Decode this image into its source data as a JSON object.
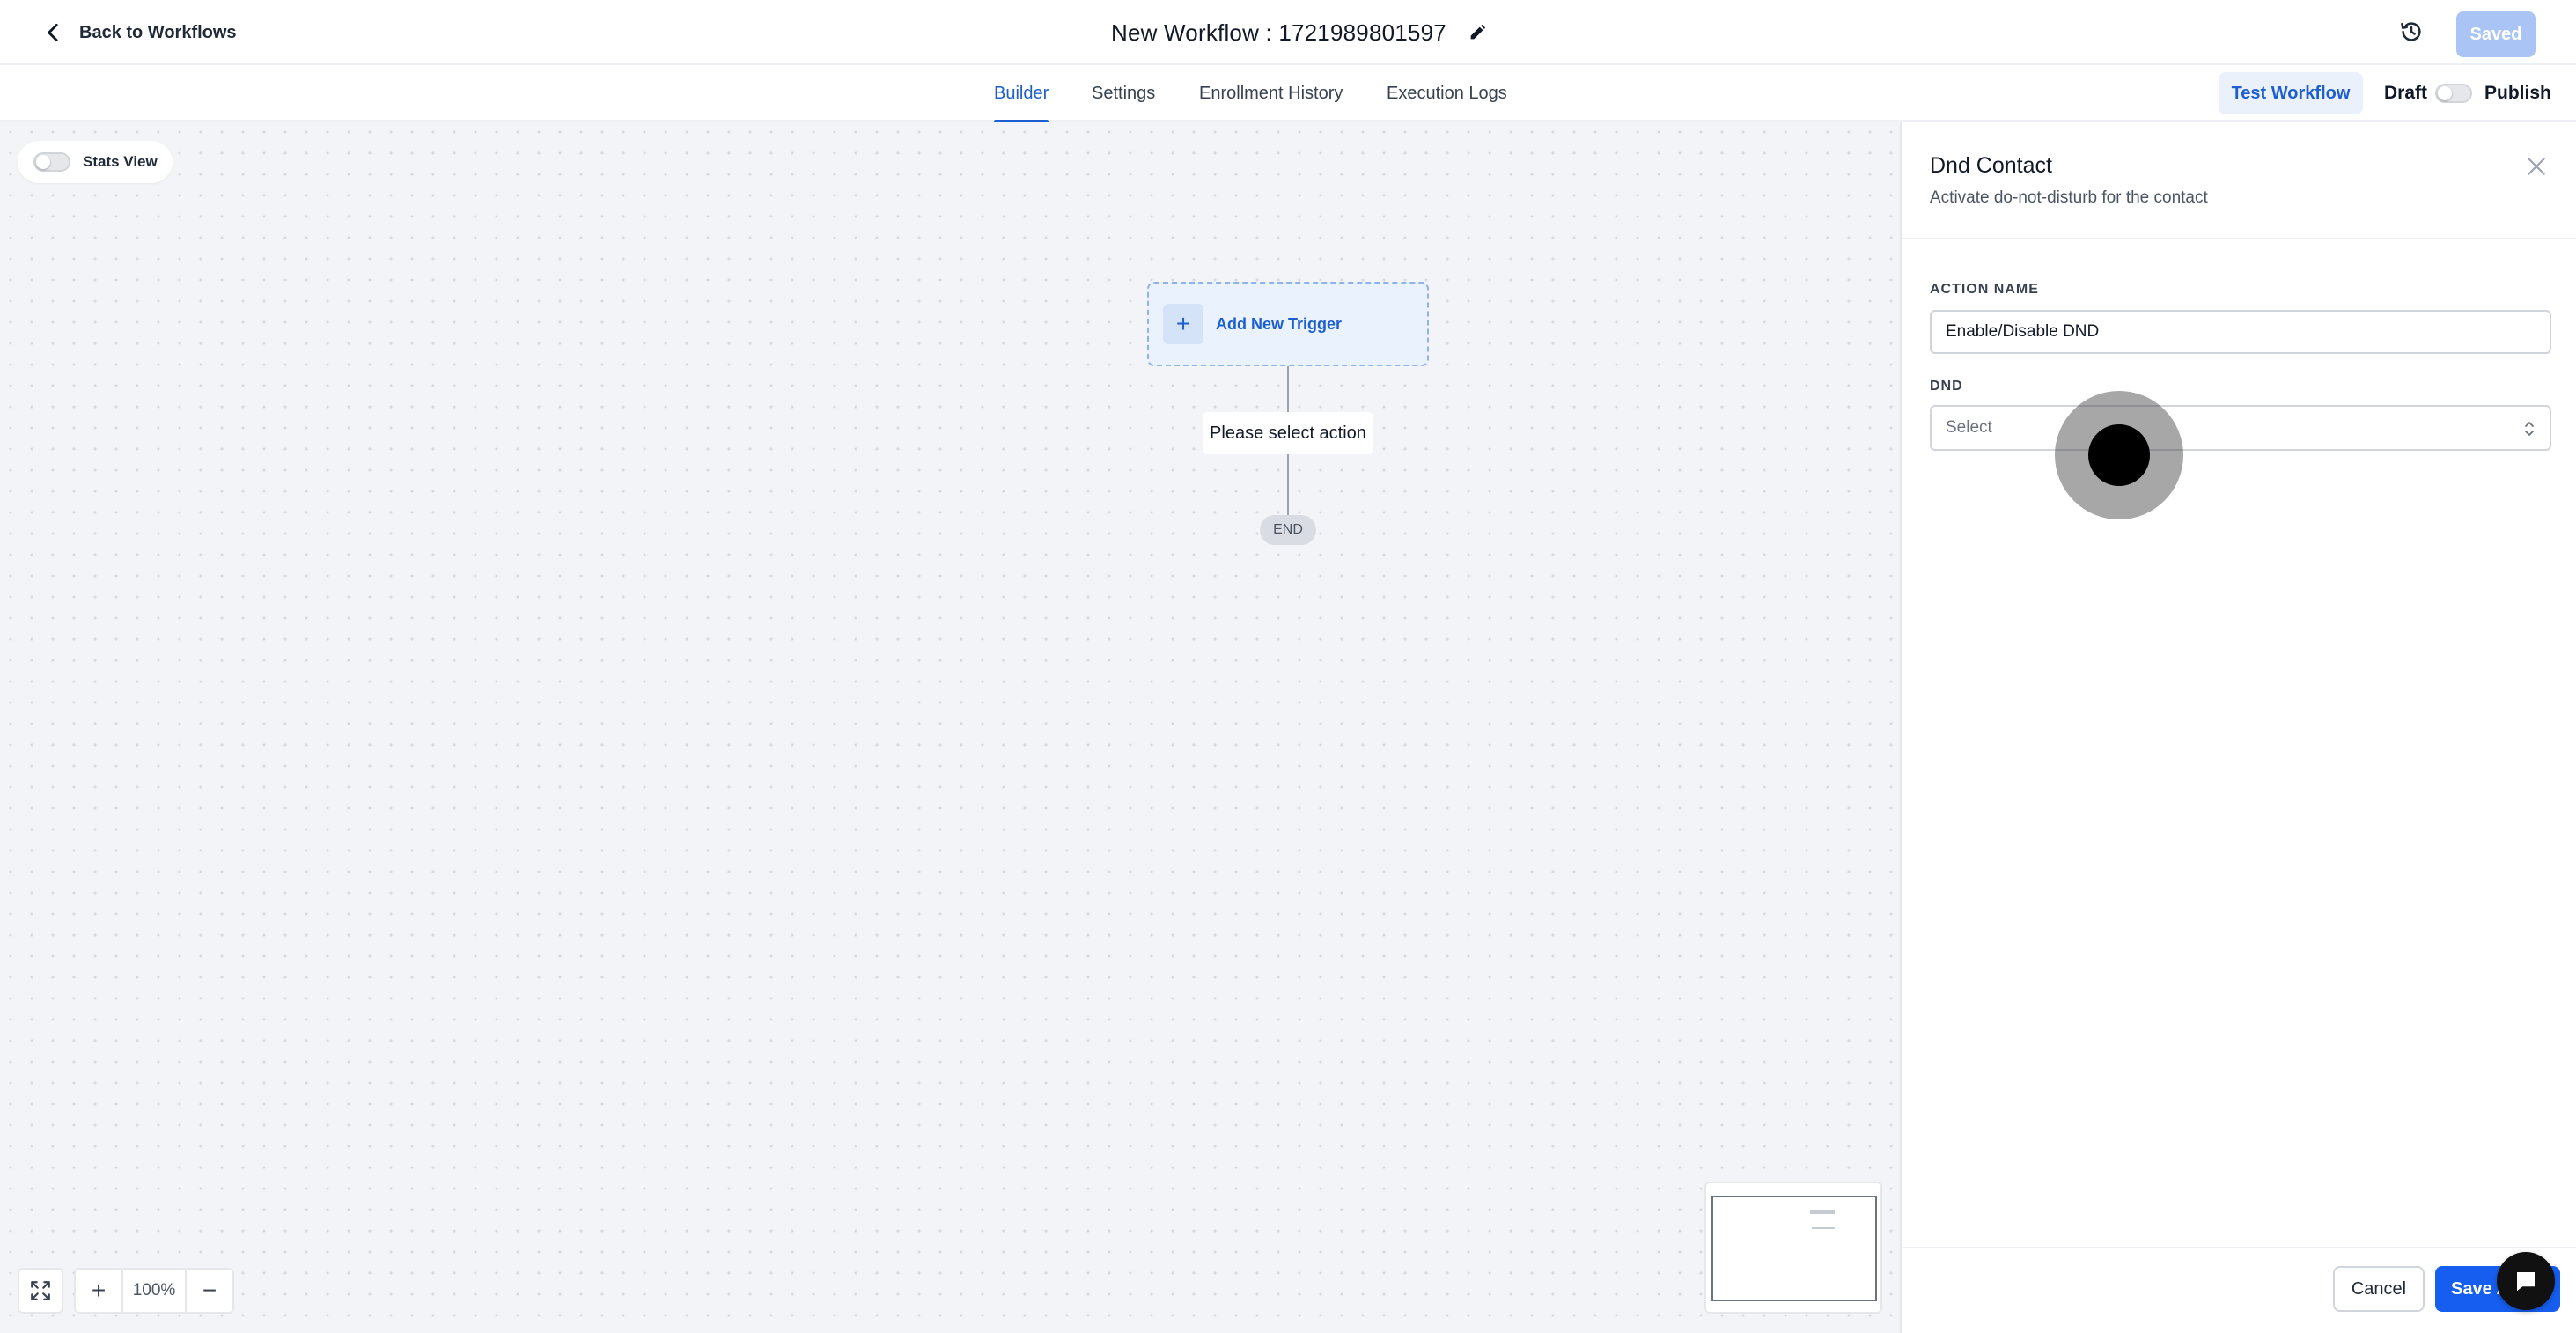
{
  "header": {
    "back_label": "Back to Workflows",
    "workflow_title": "New Workflow : 1721989801597",
    "saved_label": "Saved"
  },
  "tabs": [
    {
      "label": "Builder",
      "active": true
    },
    {
      "label": "Settings",
      "active": false
    },
    {
      "label": "Enrollment History",
      "active": false
    },
    {
      "label": "Execution Logs",
      "active": false
    }
  ],
  "toolbar": {
    "test_label": "Test Workflow",
    "draft_label": "Draft",
    "publish_label": "Publish",
    "publish_on": false
  },
  "canvas": {
    "stats_view_label": "Stats View",
    "stats_view_on": false,
    "trigger_label": "Add New Trigger",
    "action_placeholder": "Please select action",
    "end_label": "END",
    "zoom_label": "100%"
  },
  "panel": {
    "title": "Dnd Contact",
    "subtitle": "Activate do-not-disturb for the contact",
    "action_name_label": "ACTION NAME",
    "action_name_value": "Enable/Disable DND",
    "dnd_label": "DND",
    "dnd_placeholder": "Select",
    "cancel_label": "Cancel",
    "save_label": "Save Action"
  },
  "colors": {
    "accent": "#155eef",
    "tab_active": "#1d5fd1",
    "saved_disabled": "#a9c4f5",
    "canvas_bg": "#f3f4f8"
  },
  "icons": {
    "back": "chevron-left-icon",
    "edit": "pencil-icon",
    "history": "history-clock-icon",
    "close": "close-icon",
    "select_caret": "up-down-chevron-icon",
    "fit": "fit-to-screen-icon",
    "chat": "chat-bubble-icon"
  }
}
